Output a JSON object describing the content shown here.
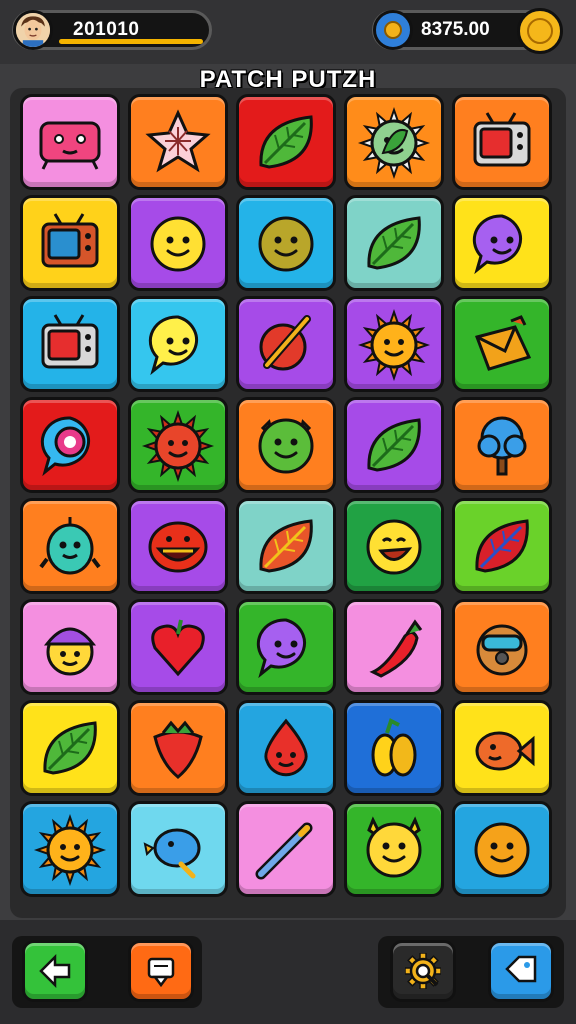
{
  "hud": {
    "score": "201010",
    "coins": "8375.00"
  },
  "title": "PATCH PUTZH",
  "colors": {
    "background": "#3d3d3f",
    "board": "#2a2a2b",
    "score_bar": "#f5b400",
    "coin": "#f5b71a"
  },
  "board": {
    "rows": 8,
    "cols": 5,
    "tiles": [
      {
        "row": 0,
        "col": 0,
        "bg": "#f48fe0",
        "icon": "pink-box-creature-icon"
      },
      {
        "row": 0,
        "col": 1,
        "bg": "#ff7f1f",
        "icon": "star-flower-icon"
      },
      {
        "row": 0,
        "col": 2,
        "bg": "#e31b1b",
        "icon": "leaf-icon"
      },
      {
        "row": 0,
        "col": 3,
        "bg": "#ff8c1a",
        "icon": "sun-leaf-badge-icon"
      },
      {
        "row": 0,
        "col": 4,
        "bg": "#ff7f1f",
        "icon": "tv-screen-icon"
      },
      {
        "row": 1,
        "col": 0,
        "bg": "#ffd21a",
        "icon": "radio-box-icon"
      },
      {
        "row": 1,
        "col": 1,
        "bg": "#a64be8",
        "icon": "yellow-smiley-icon"
      },
      {
        "row": 1,
        "col": 2,
        "bg": "#24b3e8",
        "icon": "olive-smiley-icon"
      },
      {
        "row": 1,
        "col": 3,
        "bg": "#7fd3c8",
        "icon": "leaf-icon"
      },
      {
        "row": 1,
        "col": 4,
        "bg": "#ffe21a",
        "icon": "purple-bubble-face-icon"
      },
      {
        "row": 2,
        "col": 0,
        "bg": "#24b3e8",
        "icon": "tv-screen-icon"
      },
      {
        "row": 2,
        "col": 1,
        "bg": "#35c6ee",
        "icon": "yellow-bubble-face-icon"
      },
      {
        "row": 2,
        "col": 2,
        "bg": "#a64be8",
        "icon": "paintbrush-icon"
      },
      {
        "row": 2,
        "col": 3,
        "bg": "#a64be8",
        "icon": "sun-face-icon"
      },
      {
        "row": 2,
        "col": 4,
        "bg": "#34b52a",
        "icon": "envelope-icon"
      },
      {
        "row": 3,
        "col": 0,
        "bg": "#e31b1b",
        "icon": "eye-bubble-icon"
      },
      {
        "row": 3,
        "col": 1,
        "bg": "#34b52a",
        "icon": "red-sun-face-icon"
      },
      {
        "row": 3,
        "col": 2,
        "bg": "#ff7f1f",
        "icon": "green-cat-face-icon"
      },
      {
        "row": 3,
        "col": 3,
        "bg": "#a64be8",
        "icon": "leaf-icon"
      },
      {
        "row": 3,
        "col": 4,
        "bg": "#ff7f1f",
        "icon": "blue-tree-icon"
      },
      {
        "row": 4,
        "col": 0,
        "bg": "#ff7f1f",
        "icon": "teal-creature-icon"
      },
      {
        "row": 4,
        "col": 1,
        "bg": "#a64be8",
        "icon": "red-mouth-face-icon"
      },
      {
        "row": 4,
        "col": 2,
        "bg": "#7fd3c8",
        "icon": "autumn-leaf-icon"
      },
      {
        "row": 4,
        "col": 3,
        "bg": "#21a244",
        "icon": "laughing-smiley-icon"
      },
      {
        "row": 4,
        "col": 4,
        "bg": "#6ad22a",
        "icon": "red-leaf-icon"
      },
      {
        "row": 5,
        "col": 0,
        "bg": "#f48fe0",
        "icon": "hat-face-icon"
      },
      {
        "row": 5,
        "col": 1,
        "bg": "#a64be8",
        "icon": "apple-heart-icon"
      },
      {
        "row": 5,
        "col": 2,
        "bg": "#34b52a",
        "icon": "purple-bubble-face-icon"
      },
      {
        "row": 5,
        "col": 3,
        "bg": "#f48fe0",
        "icon": "chili-pepper-icon"
      },
      {
        "row": 5,
        "col": 4,
        "bg": "#ff7f1f",
        "icon": "robot-head-icon"
      },
      {
        "row": 6,
        "col": 0,
        "bg": "#ffe21a",
        "icon": "leaf-icon"
      },
      {
        "row": 6,
        "col": 1,
        "bg": "#ff7f1f",
        "icon": "strawberry-icon"
      },
      {
        "row": 6,
        "col": 2,
        "bg": "#24a5e0",
        "icon": "red-drop-face-icon"
      },
      {
        "row": 6,
        "col": 3,
        "bg": "#1f6fd8",
        "icon": "yellow-squash-icon"
      },
      {
        "row": 6,
        "col": 4,
        "bg": "#ffe21a",
        "icon": "fish-face-icon"
      },
      {
        "row": 7,
        "col": 0,
        "bg": "#24a5e0",
        "icon": "sun-face-icon"
      },
      {
        "row": 7,
        "col": 1,
        "bg": "#6fd8ee",
        "icon": "blue-bird-icon"
      },
      {
        "row": 7,
        "col": 2,
        "bg": "#f48fe0",
        "icon": "pencil-icon"
      },
      {
        "row": 7,
        "col": 3,
        "bg": "#34b52a",
        "icon": "cat-face-icon"
      },
      {
        "row": 7,
        "col": 4,
        "bg": "#24a5e0",
        "icon": "orange-smiley-icon"
      }
    ]
  },
  "bottom": {
    "buttons": [
      {
        "name": "back-button",
        "bg": "#34c23a",
        "icon": "back-arrow-icon"
      },
      {
        "name": "menu-button",
        "bg": "#ff6a14",
        "icon": "scroll-menu-icon"
      },
      {
        "name": "settings-button",
        "bg": "#2a2a2a",
        "icon": "gear-magnifier-icon"
      },
      {
        "name": "tag-button",
        "bg": "#2b9ae8",
        "icon": "tag-icon"
      }
    ]
  }
}
